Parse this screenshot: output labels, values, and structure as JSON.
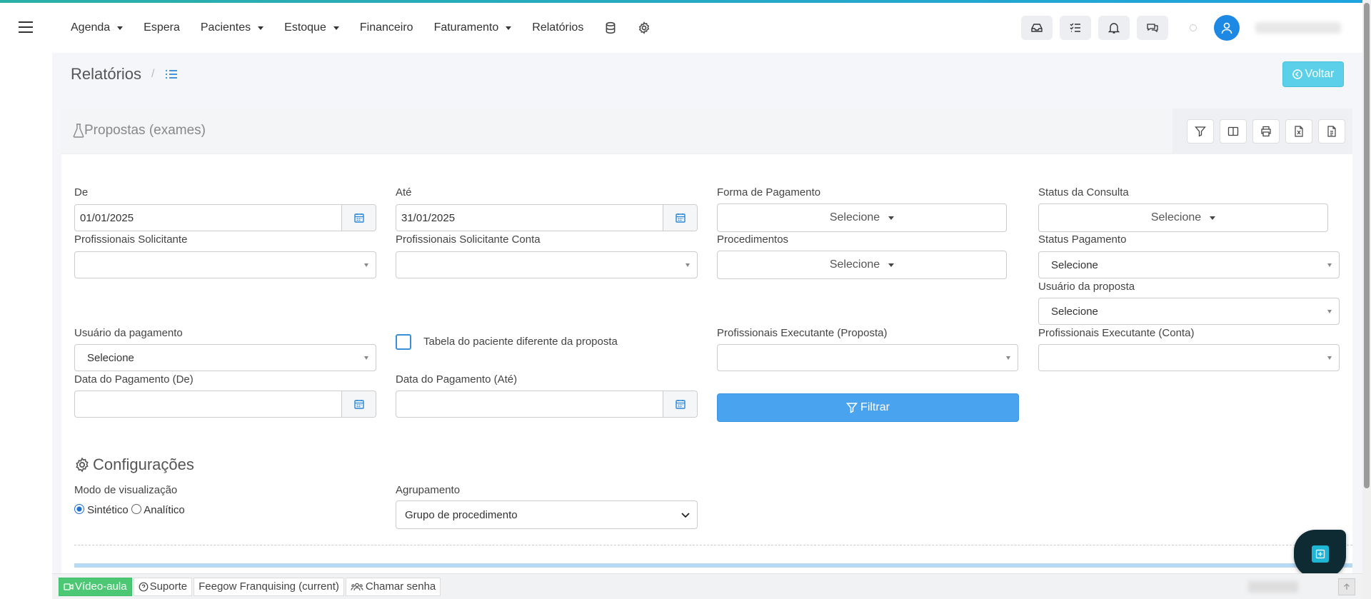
{
  "nav": {
    "items": [
      {
        "label": "Agenda",
        "dropdown": true
      },
      {
        "label": "Espera",
        "dropdown": false
      },
      {
        "label": "Pacientes",
        "dropdown": true
      },
      {
        "label": "Estoque",
        "dropdown": true
      },
      {
        "label": "Financeiro",
        "dropdown": false
      },
      {
        "label": "Faturamento",
        "dropdown": true
      },
      {
        "label": "Relatórios",
        "dropdown": false
      }
    ],
    "icons": [
      "database-icon",
      "gear-icon"
    ],
    "right_icons": [
      "inbox-icon",
      "tasks-icon",
      "bell-icon",
      "chat-icon"
    ]
  },
  "breadcrumb": {
    "title": "Relatórios",
    "separator": "/",
    "back_label": "Voltar"
  },
  "panel": {
    "title": "Propostas (exames)",
    "tools": [
      "filter-icon",
      "columns-icon",
      "print-icon",
      "excel-icon",
      "pdf-icon"
    ]
  },
  "form": {
    "de": {
      "label": "De",
      "value": "01/01/2025"
    },
    "ate": {
      "label": "Até",
      "value": "31/01/2025"
    },
    "forma_pagamento": {
      "label": "Forma de Pagamento",
      "value": "Selecione"
    },
    "status_consulta": {
      "label": "Status da Consulta",
      "value": "Selecione"
    },
    "prof_solicitante": {
      "label": "Profissionais Solicitante",
      "value": ""
    },
    "prof_solicitante_conta": {
      "label": "Profissionais Solicitante Conta",
      "value": ""
    },
    "procedimentos": {
      "label": "Procedimentos",
      "value": "Selecione"
    },
    "status_pagamento": {
      "label": "Status Pagamento",
      "value": "Selecione"
    },
    "usuario_proposta": {
      "label": "Usuário da proposta",
      "value": "Selecione"
    },
    "usuario_pagamento": {
      "label": "Usuário da pagamento",
      "value": "Selecione"
    },
    "tabela_diferente": {
      "label": "Tabela do paciente diferente da proposta",
      "checked": false
    },
    "prof_exec_proposta": {
      "label": "Profissionais Executante (Proposta)",
      "value": ""
    },
    "prof_exec_conta": {
      "label": "Profissionais Executante (Conta)",
      "value": ""
    },
    "data_pag_de": {
      "label": "Data do Pagamento (De)",
      "value": ""
    },
    "data_pag_ate": {
      "label": "Data do Pagamento (Até)",
      "value": ""
    },
    "filter_label": "Filtrar"
  },
  "config": {
    "title": "Configurações",
    "modo_label": "Modo de visualização",
    "modo_options": [
      {
        "label": "Sintético",
        "checked": true
      },
      {
        "label": "Analítico",
        "checked": false
      }
    ],
    "agrupamento_label": "Agrupamento",
    "agrupamento_value": "Grupo de procedimento"
  },
  "footer": {
    "video": "Vídeo-aula",
    "suporte": "Suporte",
    "franquia": "Feegow Franquising (current)",
    "chamar": "Chamar senha"
  },
  "colors": {
    "accent": "#4aa3ee",
    "back_button": "#5bd0e8",
    "video_button": "#4cc774",
    "avatar": "#1e88e5"
  }
}
